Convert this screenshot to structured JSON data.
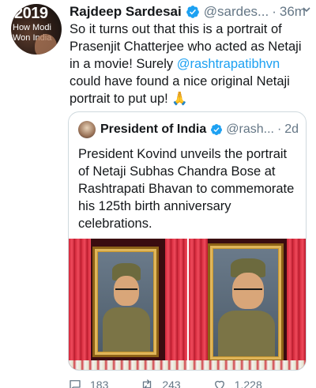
{
  "tweet": {
    "avatar_text": {
      "year": "2019",
      "line1": "How Modi",
      "line2": "Won India"
    },
    "author_name": "Rajdeep Sardesai",
    "handle": "@sardes...",
    "separator": "·",
    "time": "36m",
    "text_before": "So it turns out that this is a portrait of Prasenjit Chatterjee who acted as Netaji in a movie! Surely ",
    "mention": "@rashtrapatibhvn",
    "text_after": " could have found a nice original Netaji portrait to put up! 🙏"
  },
  "quoted": {
    "author_name": "President of India",
    "handle": "@rash...",
    "separator": "·",
    "time": "2d",
    "text": "President Kovind unveils the portrait of Netaji Subhas Chandra Bose at Rashtrapati Bhavan to commemorate his 125th birth anniversary celebrations."
  },
  "actions": {
    "replies": "183",
    "retweets": "243",
    "likes": "1,228"
  },
  "colors": {
    "link": "#1da1f2",
    "secondary_text": "#657786",
    "verified_badge": "#1da1f2",
    "border": "#cfd9de"
  },
  "icons": {
    "verified": "verified-badge-icon",
    "caret": "chevron-down-icon",
    "reply": "reply-icon",
    "retweet": "retweet-icon",
    "like": "heart-icon"
  }
}
